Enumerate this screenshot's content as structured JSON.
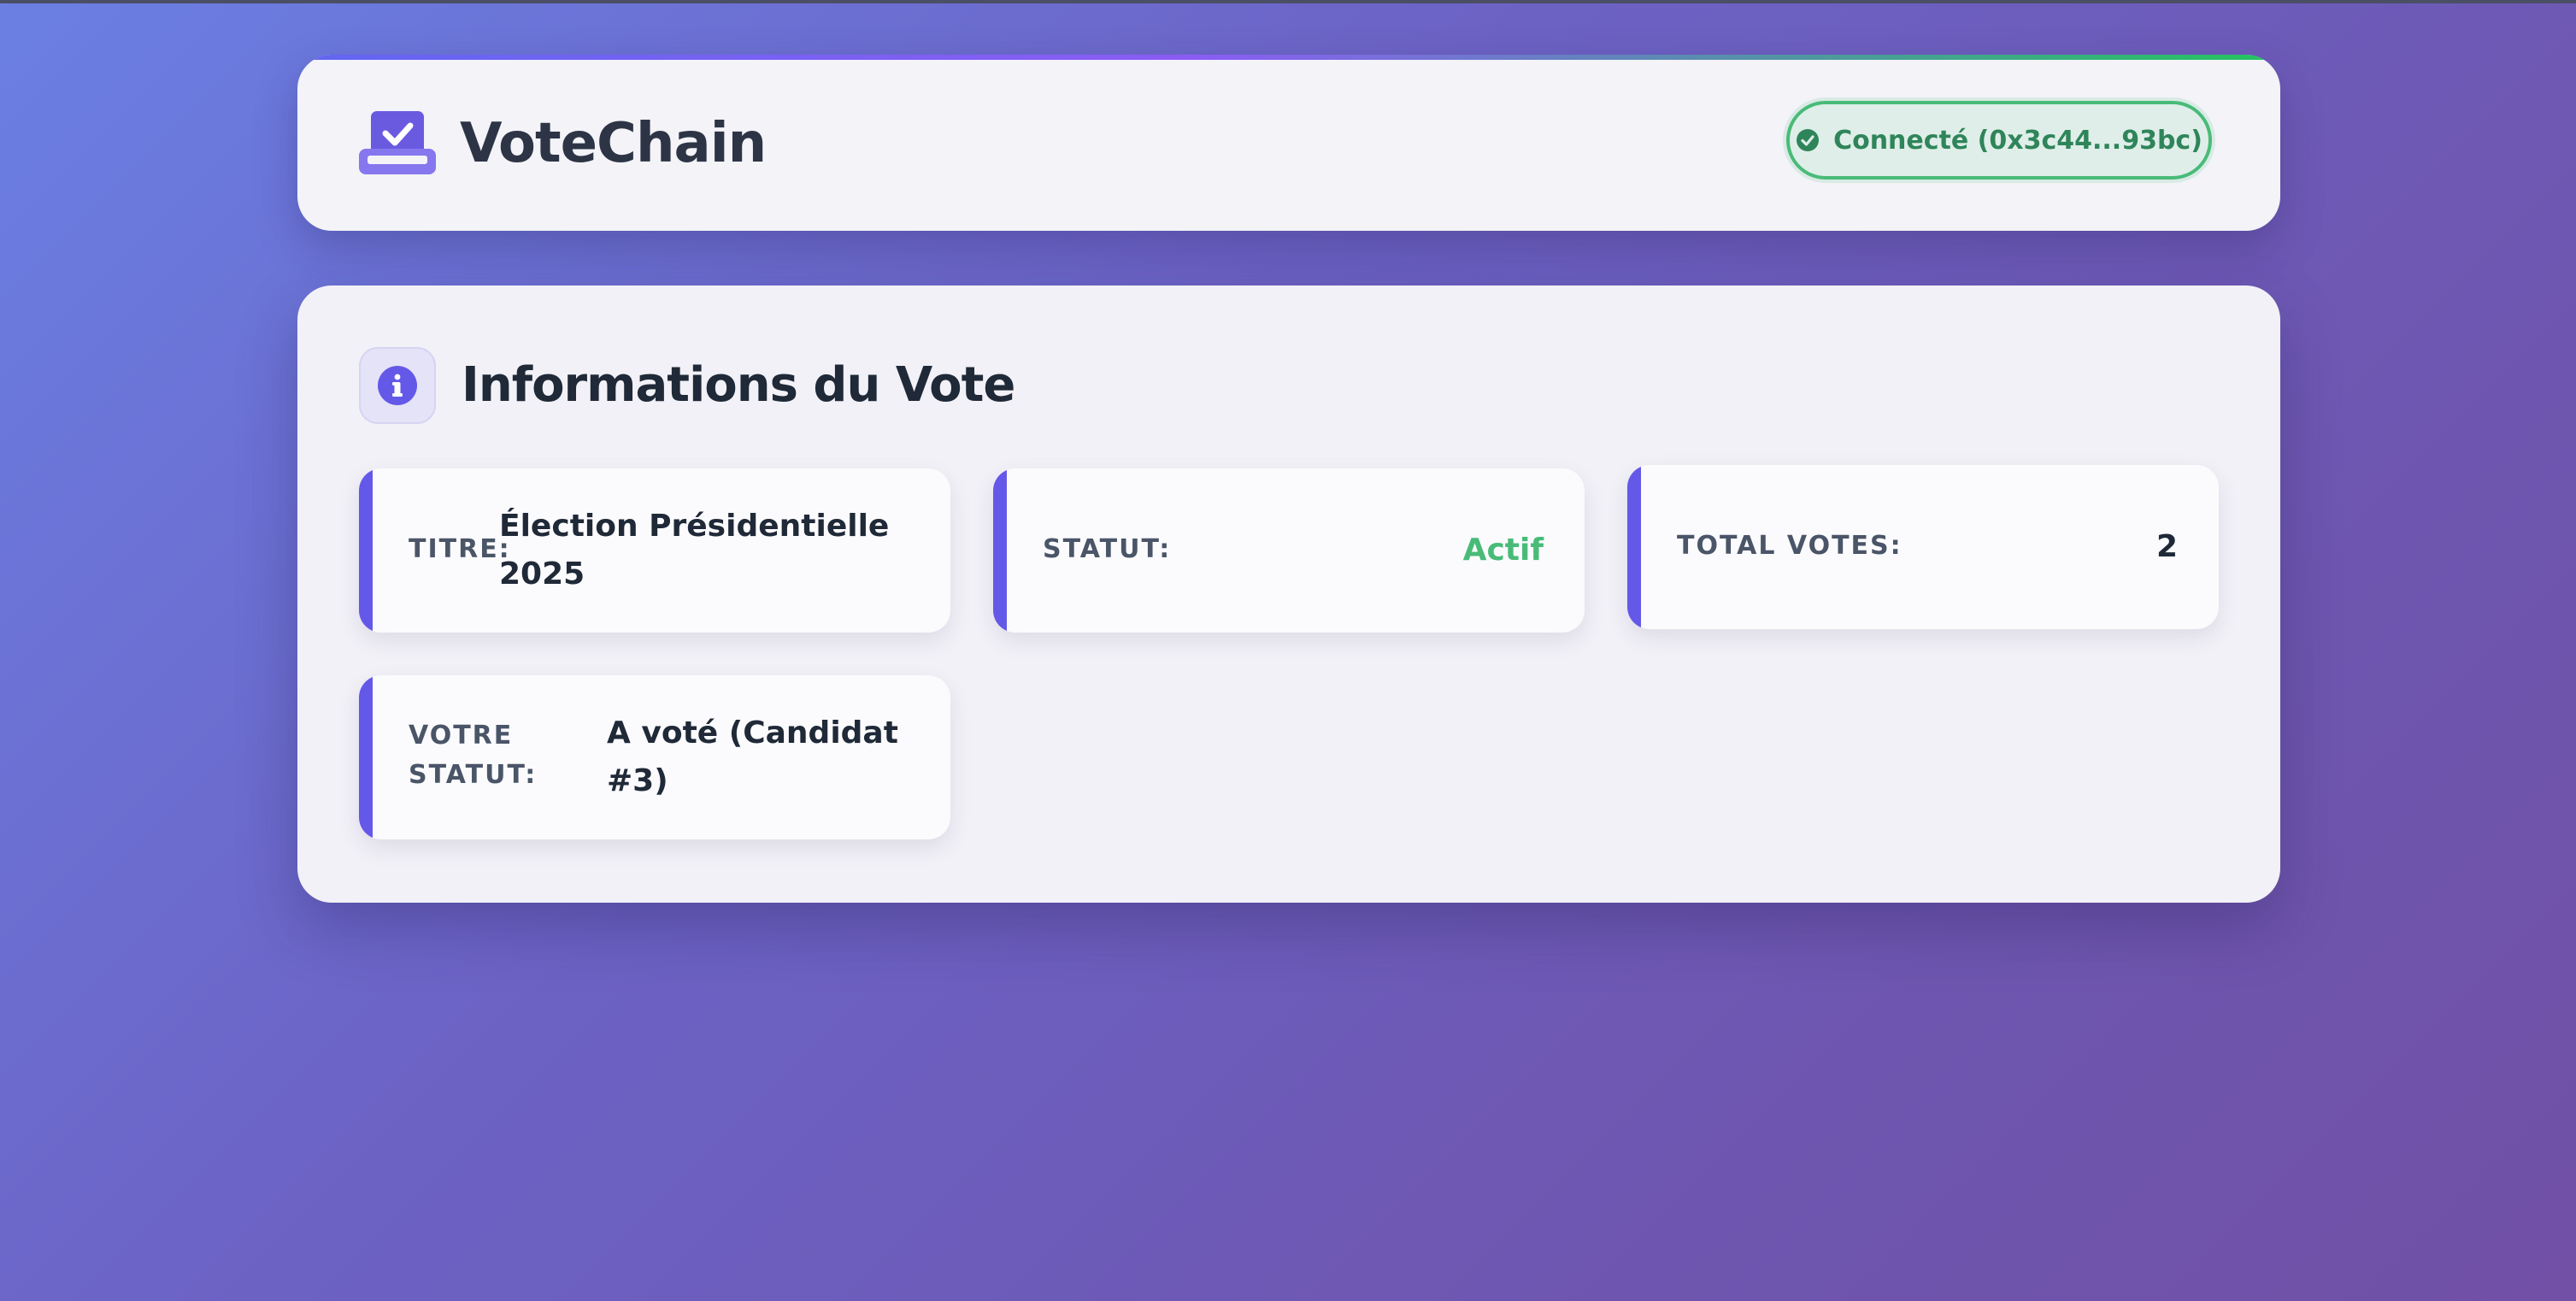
{
  "app": {
    "brand": "VoteChain",
    "connection_status": "Connecté (0x3c44...93bc)",
    "icons": {
      "logo": "ballot-box-check-icon",
      "connection": "check-circle-icon",
      "info": "info-circle-icon"
    },
    "colors": {
      "accent": "#6458e8",
      "success": "#48bb78",
      "success_text": "#2f855a"
    }
  },
  "vote_info": {
    "title": "Informations du Vote",
    "cards": [
      {
        "label": "TITRE:",
        "value": "Élection Présidentielle 2025"
      },
      {
        "label": "STATUT:",
        "value": "Actif"
      },
      {
        "label": "TOTAL VOTES:",
        "value": "2"
      },
      {
        "label": "VOTRE STATUT:",
        "value": "A voté (Candidat #3)"
      }
    ]
  }
}
